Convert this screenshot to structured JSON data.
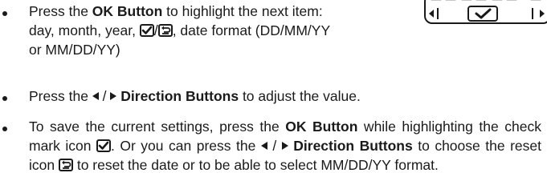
{
  "bullets": [
    {
      "intro": "Press the ",
      "ok_button": "OK Button",
      "mid": " to highlight the next item:",
      "line2_start": "day, month, year, ",
      "sep": "/",
      "line2_end": ", date format (DD/MM/YY",
      "line3": "or MM/DD/YY)"
    },
    {
      "intro": "Press the ",
      "slash": " / ",
      "direction_buttons": "Direction Buttons",
      "end": " to adjust the value."
    },
    {
      "part1": "To save the current settings, press the ",
      "ok_button": "OK Button",
      "part2": " while highlighting the check mark icon ",
      "part3": ". Or you can press the ",
      "slash": " / ",
      "direction_buttons": "Direction Buttons",
      "part4": " to choose the reset icon ",
      "part5": " to reset the date  or to be able to select MM/DD/YY format."
    }
  ],
  "icons": {
    "check": "check-mark-icon",
    "reset": "reset-icon",
    "left": "left-direction-icon",
    "right": "right-direction-icon"
  }
}
